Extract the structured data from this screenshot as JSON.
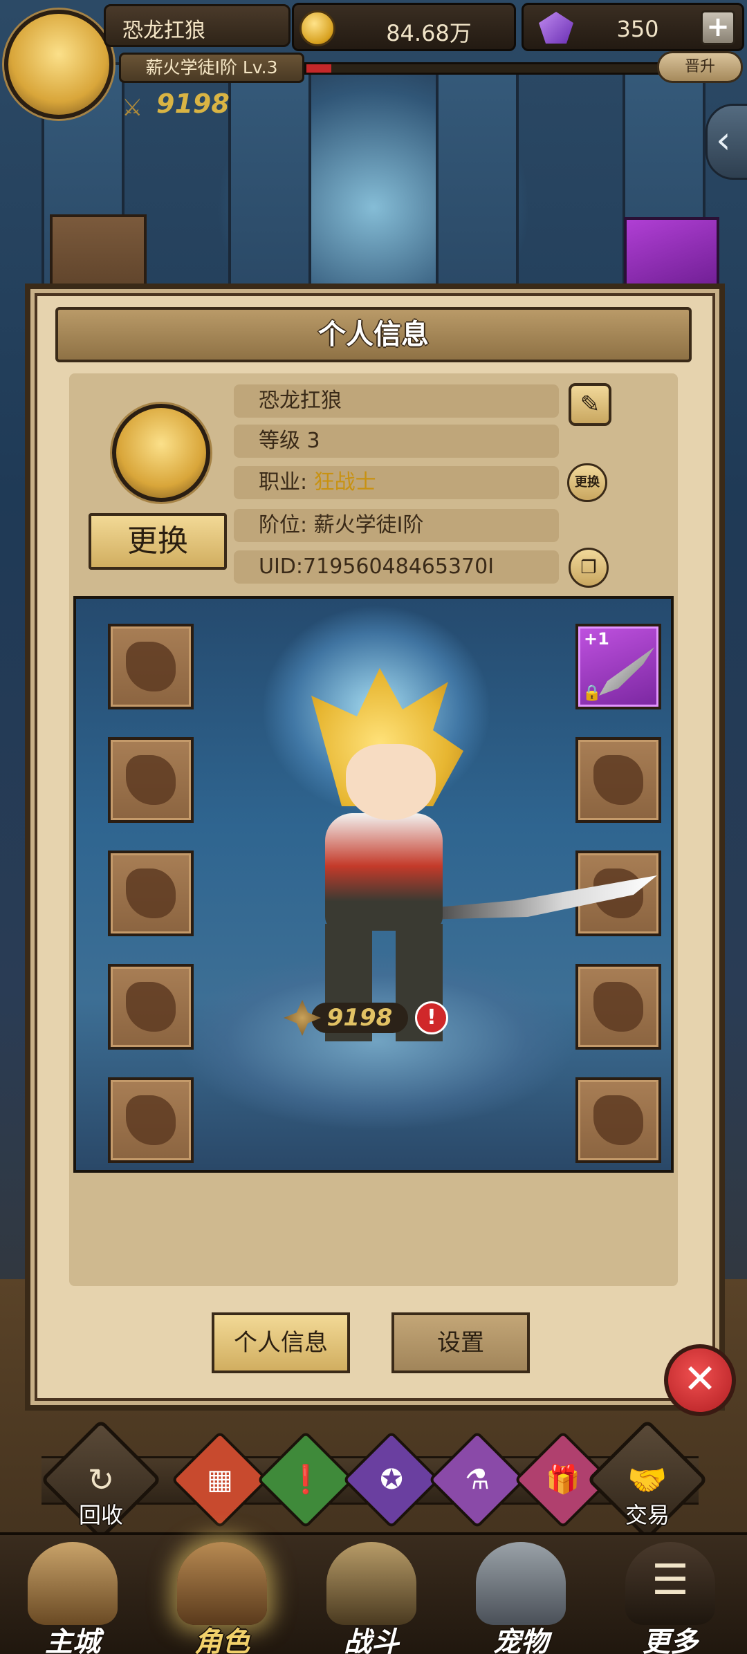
{
  "hud": {
    "player_name": "恐龙扛狼",
    "rank": "薪火学徒Ⅰ阶 Lv.3",
    "power": "9198",
    "gold": "84.68万",
    "gems": "350",
    "upgrade_label": "晋升",
    "xp_progress": 0.07
  },
  "panel": {
    "title": "个人信息",
    "name": "恐龙扛狼",
    "level": "等级 3",
    "class_label": "职业: ",
    "class_value": "狂战士",
    "tier": "阶位: 薪火学徒Ⅰ阶",
    "uid": "UID:71956048465370Ⅰ",
    "change_avatar_label": "更换",
    "change_class_label": "更换",
    "power": "9198",
    "weapon_plus": "+1",
    "tabs": [
      "个人信息",
      "设置"
    ]
  },
  "quick_actions": {
    "recycle_label": "回收",
    "trade_label": "交易",
    "colors": [
      "#c84a2e",
      "#3f8a3a",
      "#6a3fa0",
      "#8a4aa8",
      "#b0406e"
    ]
  },
  "bottom_nav": [
    {
      "label": "主城",
      "icon": "castle-icon"
    },
    {
      "label": "角色",
      "icon": "helmet-icon",
      "active": true
    },
    {
      "label": "战斗",
      "icon": "battle-icon"
    },
    {
      "label": "宠物",
      "icon": "pet-icon"
    },
    {
      "label": "更多",
      "icon": "more-icon"
    }
  ]
}
